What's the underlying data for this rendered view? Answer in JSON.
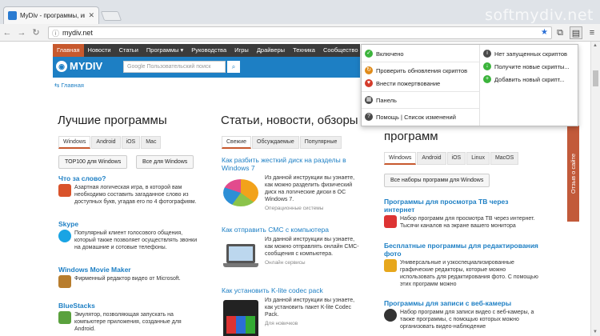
{
  "browser": {
    "tab_title": "MyDiv - программы, игр",
    "watermark": "softmydiv.net",
    "url": "mydiv.net",
    "window_buttons": [
      "—",
      "□",
      "✕"
    ]
  },
  "site": {
    "menu": [
      "Главная",
      "Новости",
      "Статьи",
      "Программы ▾",
      "Руководства",
      "Игры",
      "Драйверы",
      "Техника",
      "Сообщество"
    ],
    "logo": "MYDIV",
    "search_placeholder": "Google Пользовательский поиск",
    "breadcrumb": "Главная",
    "feedback": "Отзыв о сайте"
  },
  "left": {
    "title": "Лучшие программы",
    "filters": [
      "Windows",
      "Android",
      "iOS",
      "Mac"
    ],
    "buttons": [
      "TOP100 для Windows",
      "Все для Windows"
    ],
    "items": [
      {
        "title": "Что за слово?",
        "desc": "Азартная логическая игра, в которой вам необходимо составить загаданное слово из доступных букв, угадав его по 4 фотографиям.",
        "color": "#d9532b"
      },
      {
        "title": "Skype",
        "desc": "Популярный клиент голосового общения, который также позволяет осуществлять звонки на домашние и сотовые телефоны.",
        "color": "#1aa4e4"
      },
      {
        "title": "Windows Movie Maker",
        "desc": "Фирменный редактор видео от Microsoft.",
        "color": "#b87d2d"
      },
      {
        "title": "BlueStacks",
        "desc": "Эмулятор, позволяющая запускать на компьютере приложения, созданные для Android.",
        "color": "#5aa13d"
      }
    ]
  },
  "middle": {
    "title": "Статьи, новости, обзоры",
    "filters": [
      "Свежие",
      "Обсуждаемые",
      "Популярные"
    ],
    "articles": [
      {
        "title": "Как разбить жесткий диск на разделы в Windows 7",
        "desc": "Из данной инструкции вы узнаете, как можно разделить физический диск на логические диски в ОС Windows 7.",
        "meta": "Операционные системы"
      },
      {
        "title": "Как отправить СМС с компьютера",
        "desc": "Из данной инструкции вы узнаете, как можно отправлять онлайн СМС-сообщения с компьютера.",
        "meta": "Онлайн сервисы"
      },
      {
        "title": "Как установить K-lite codec pack",
        "desc": "Из данной инструкции вы узнаете, как установить пакет K-lite Codec Pack.",
        "meta": "Для новичков"
      }
    ]
  },
  "right": {
    "title": "программ",
    "filters": [
      "Windows",
      "Android",
      "iOS",
      "Linux",
      "MacOS"
    ],
    "button": "Все наборы программ для Windows",
    "items": [
      {
        "title": "Программы для просмотра ТВ через интернет",
        "desc": "Набор программ для просмотра ТВ через интернет. Тысячи каналов на экране вашего монитора"
      },
      {
        "title": "Бесплатные программы для редактирования фото",
        "desc": "Универсальные и узкоспециализированные графические редакторы, которые можно использовать для редактирования фото. С помощью этих программ можно"
      },
      {
        "title": "Программы для записи с веб-камеры",
        "desc": "Набор программ для записи видео с веб-камеры, а также программы, с помощью которых можно организовать видео-наблюдение"
      }
    ]
  },
  "popup": {
    "left": [
      {
        "label": "Включено",
        "icon": "check-icon",
        "color": "#3cb43c"
      },
      {
        "label": "Проверить обновления скриптов",
        "icon": "update-icon",
        "color": "#e08b1a"
      },
      {
        "label": "Внести пожертвование",
        "icon": "donate-icon",
        "color": "#d43b2b"
      },
      {
        "label": "Панель",
        "icon": "panel-icon",
        "color": "#4a4a4a"
      },
      {
        "label": "Помощь | Список изменений",
        "icon": "help-icon",
        "color": "#4a4a4a"
      }
    ],
    "right": [
      {
        "label": "Нет запущенных скриптов",
        "icon": "info-icon",
        "color": "#4a4a4a"
      },
      {
        "label": "Получите новые скрипты...",
        "icon": "download-icon",
        "color": "#3cb43c"
      },
      {
        "label": "Добавить новый скрипт...",
        "icon": "add-icon",
        "color": "#3cb43c"
      }
    ]
  }
}
